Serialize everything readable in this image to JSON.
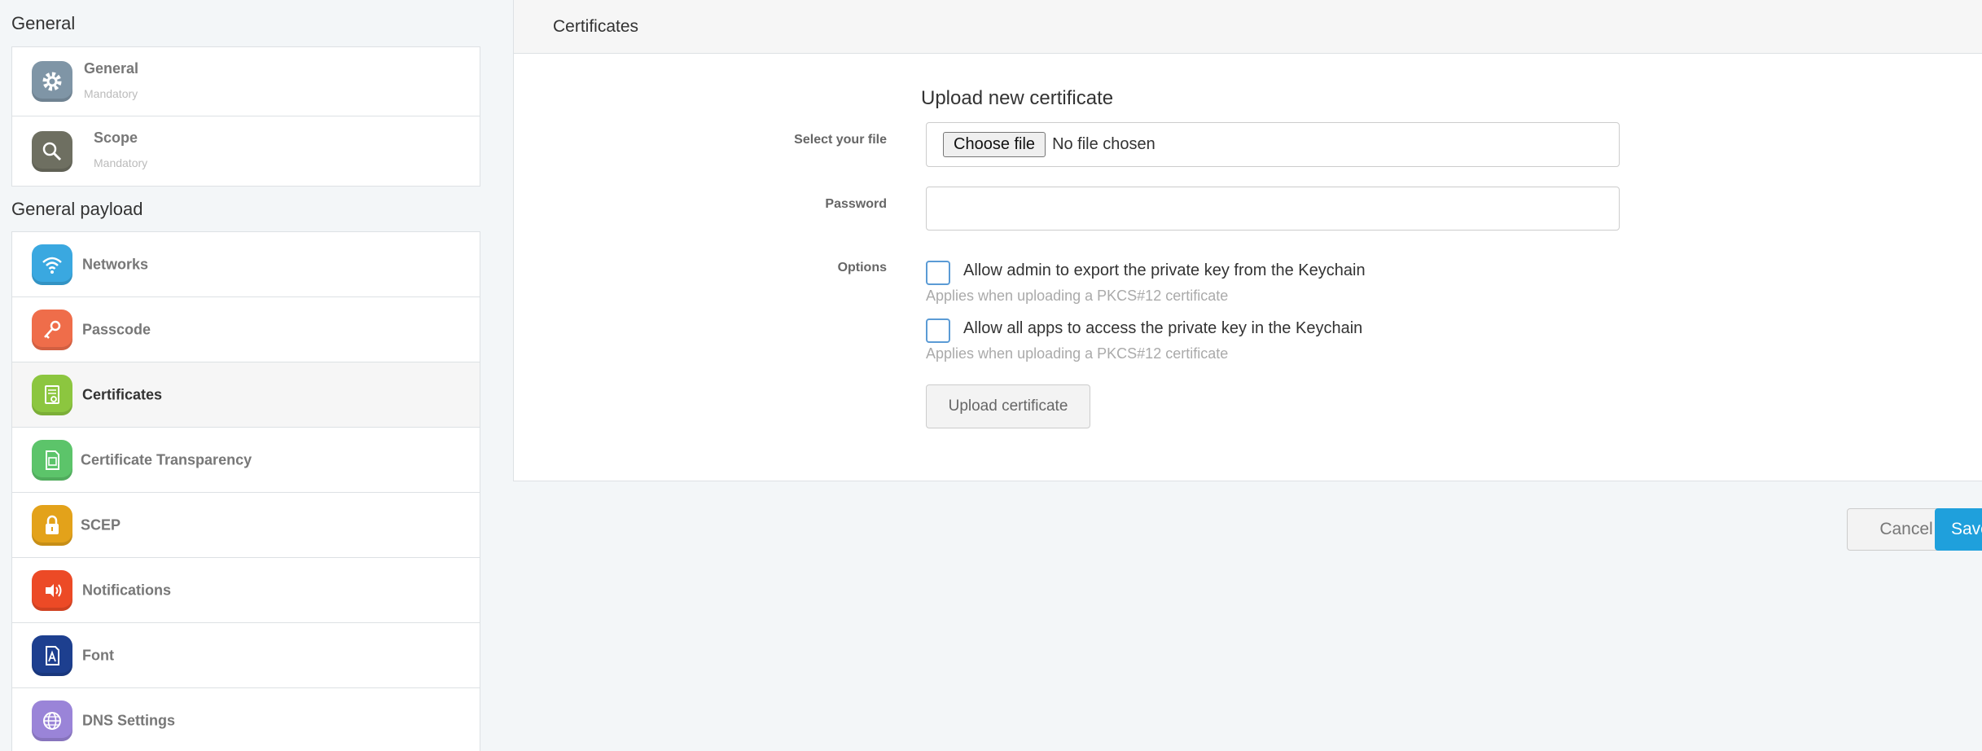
{
  "sidebar": {
    "general_title": "General",
    "payload_title": "General payload",
    "general_items": [
      {
        "label": "General",
        "sub": "Mandatory",
        "icon": "gear-icon",
        "color": "#7f95a6"
      },
      {
        "label": "Scope",
        "sub": "Mandatory",
        "icon": "magnifier-icon",
        "color": "#6e6f61"
      }
    ],
    "payload_items": [
      {
        "label": "Networks",
        "icon": "wifi-icon",
        "color": "#3aa8e0"
      },
      {
        "label": "Passcode",
        "icon": "key-icon",
        "color": "#ef6d4a"
      },
      {
        "label": "Certificates",
        "icon": "certificate-icon",
        "color": "#8cc63f",
        "active": true
      },
      {
        "label": "Certificate Transparency",
        "icon": "document-icon",
        "color": "#5cc46a"
      },
      {
        "label": "SCEP",
        "icon": "lock-icon",
        "color": "#e3a21a"
      },
      {
        "label": "Notifications",
        "icon": "notification-icon",
        "color": "#ec4a26"
      },
      {
        "label": "Font",
        "icon": "font-file-icon",
        "color": "#1d3f8f"
      },
      {
        "label": "DNS Settings",
        "icon": "globe-icon",
        "color": "#9a84d8"
      }
    ]
  },
  "card": {
    "header_title": "Certificates",
    "form_heading": "Upload new certificate",
    "file_label": "Select your file",
    "choose_file": "Choose file",
    "no_file": "No file chosen",
    "password_label": "Password",
    "password_value": "",
    "options_label": "Options",
    "option1_label": "Allow admin to export the private key from the Keychain",
    "option1_help": "Applies when uploading a PKCS#12 certificate",
    "option2_label": "Allow all apps to access the private key in the Keychain",
    "option2_help": "Applies when uploading a PKCS#12 certificate",
    "upload_button": "Upload certificate"
  },
  "footer": {
    "cancel": "Cancel",
    "save": "Save"
  }
}
